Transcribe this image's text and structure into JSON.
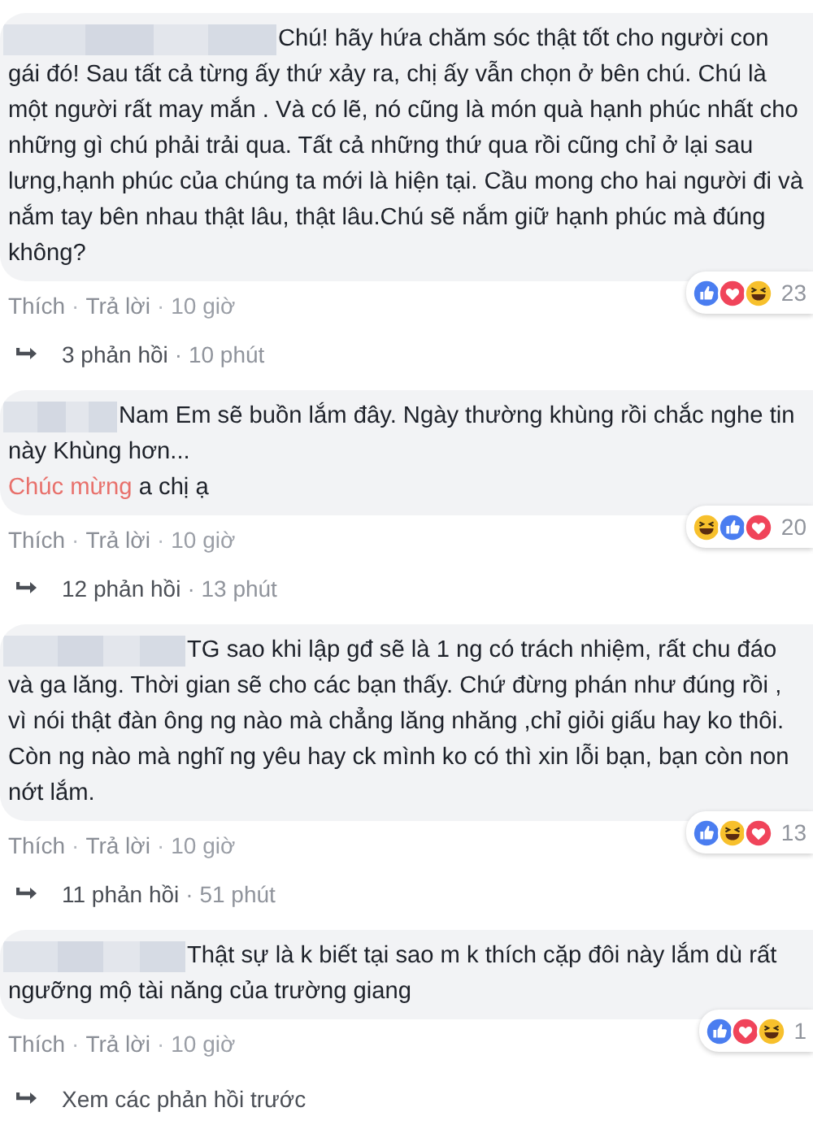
{
  "comments": [
    {
      "paragraphs": [
        [
          {
            "kind": "text",
            "text": "Chú! hãy hứa chăm sóc thật tốt cho người con gái đó! Sau tất cả từng ấy thứ xảy ra, chị ấy vẫn chọn ở bên chú. Chú là một người rất may mắn . Và có lẽ, nó cũng là món quà hạnh phúc nhất cho những gì chú phải trải qua. Tất cả những thứ qua rồi cũng chỉ ở lại sau lưng,hạnh phúc của chúng ta mới là hiện tại. Cầu mong cho hai người đi và nắm tay bên nhau thật lâu, thật lâu.Chú sẽ nắm giữ hạnh phúc mà đúng không?"
          }
        ]
      ],
      "reactions": [
        {
          "kind": "like"
        },
        {
          "kind": "love"
        },
        {
          "kind": "haha"
        }
      ],
      "reaction_count": "23",
      "meta": [
        {
          "kind": "link",
          "text": "Thích"
        },
        {
          "kind": "sep",
          "text": "·"
        },
        {
          "kind": "link",
          "text": "Trả lời"
        },
        {
          "kind": "sep",
          "text": "·"
        },
        {
          "kind": "time",
          "text": "10 giờ"
        }
      ],
      "replies": {
        "label": "3 phản hồi",
        "time": "· 10 phút"
      }
    },
    {
      "paragraphs": [
        [
          {
            "kind": "text",
            "text": "Nam Em sẽ buồn lắm đây. Ngày thường khùng rồi chắc nghe tin này Khùng hơn..."
          }
        ],
        [
          {
            "kind": "mention",
            "text": "Chúc mừng"
          },
          {
            "kind": "text",
            "text": " a chị ạ"
          }
        ]
      ],
      "reactions": [
        {
          "kind": "haha"
        },
        {
          "kind": "like"
        },
        {
          "kind": "love"
        }
      ],
      "reaction_count": "20",
      "meta": [
        {
          "kind": "link",
          "text": "Thích"
        },
        {
          "kind": "sep",
          "text": "·"
        },
        {
          "kind": "link",
          "text": "Trả lời"
        },
        {
          "kind": "sep",
          "text": "·"
        },
        {
          "kind": "time",
          "text": "10 giờ"
        }
      ],
      "replies": {
        "label": "12 phản hồi",
        "time": "· 13 phút"
      }
    },
    {
      "paragraphs": [
        [
          {
            "kind": "text",
            "text": "TG sao khi lập gđ sẽ là 1 ng có trách nhiệm, rất chu đáo và ga lăng. Thời gian sẽ cho các bạn thấy. Chứ đừng phán như đúng rồi , vì nói thật đàn ông ng nào mà chẳng lăng nhăng ,chỉ giỏi giấu hay ko thôi. Còn ng nào mà nghĩ ng yêu hay ck mình ko có thì xin lỗi bạn, bạn còn non nớt lắm."
          }
        ]
      ],
      "reactions": [
        {
          "kind": "like"
        },
        {
          "kind": "haha"
        },
        {
          "kind": "love"
        }
      ],
      "reaction_count": "13",
      "meta": [
        {
          "kind": "link",
          "text": "Thích"
        },
        {
          "kind": "sep",
          "text": "·"
        },
        {
          "kind": "link",
          "text": "Trả lời"
        },
        {
          "kind": "sep",
          "text": "·"
        },
        {
          "kind": "time",
          "text": "10 giờ"
        }
      ],
      "replies": {
        "label": "11 phản hồi",
        "time": "· 51 phút"
      }
    },
    {
      "paragraphs": [
        [
          {
            "kind": "text",
            "text": "Thật sự là k biết tại sao m k thích cặp đôi này lắm dù rất ngưỡng mộ tài năng của trường giang"
          }
        ]
      ],
      "reactions": [
        {
          "kind": "like"
        },
        {
          "kind": "love"
        },
        {
          "kind": "haha"
        }
      ],
      "reaction_count": "1",
      "meta": [
        {
          "kind": "link",
          "text": "Thích"
        },
        {
          "kind": "sep",
          "text": "·"
        },
        {
          "kind": "link",
          "text": "Trả lời"
        },
        {
          "kind": "sep",
          "text": "·"
        },
        {
          "kind": "time",
          "text": "10 giờ"
        }
      ]
    }
  ],
  "more_replies": {
    "label": "Xem các phản hồi trước"
  }
}
